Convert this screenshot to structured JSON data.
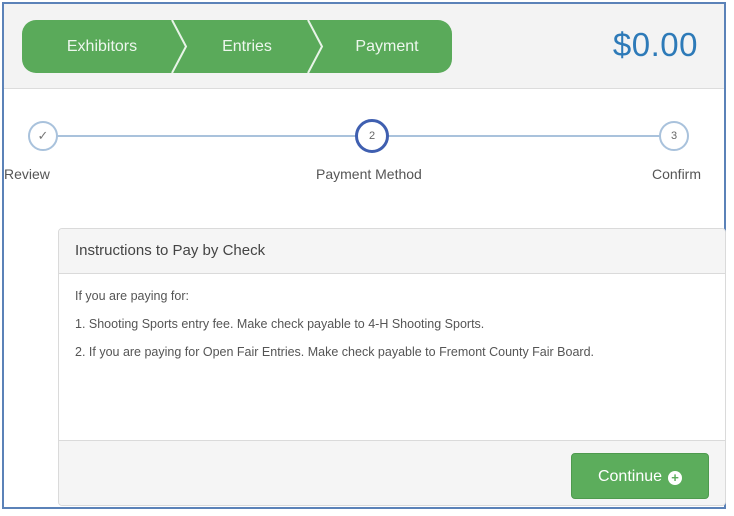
{
  "wizard": {
    "crumbs": [
      "Exhibitors",
      "Entries",
      "Payment"
    ],
    "total": "$0.00"
  },
  "steps": [
    {
      "label": "Review",
      "marker": "✓",
      "state": "complete"
    },
    {
      "label": "Payment Method",
      "marker": "2",
      "state": "active"
    },
    {
      "label": "Confirm",
      "marker": "3",
      "state": "pending"
    }
  ],
  "instructions": {
    "title": "Instructions to Pay by Check",
    "lines": [
      "If you are paying for:",
      "1. Shooting Sports entry fee. Make check payable to 4-H Shooting Sports.",
      "2. If you are paying for Open Fair Entries. Make check payable to Fremont County Fair Board."
    ]
  },
  "footer": {
    "continue_label": "Continue"
  },
  "colors": {
    "accent_green": "#5aaa5a",
    "total_blue": "#2d7ab8",
    "active_step_border": "#3f5fb0",
    "step_border": "#a9c2dc"
  }
}
